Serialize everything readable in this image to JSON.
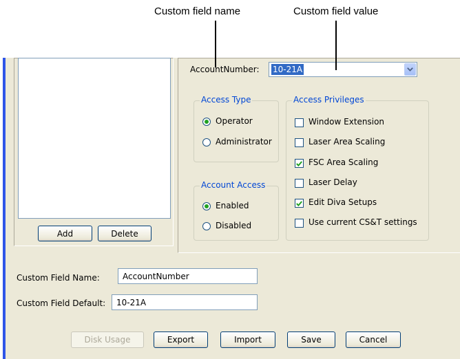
{
  "callouts": {
    "name_label": "Custom field name",
    "value_label": "Custom field value"
  },
  "account_field": {
    "label": "AccountNumber:",
    "value": "10-21A",
    "dropdown_icon": "chevron-down-icon"
  },
  "list_buttons": {
    "add": "Add",
    "delete": "Delete"
  },
  "access_type": {
    "title": "Access Type",
    "options": [
      {
        "label": "Operator",
        "selected": true
      },
      {
        "label": "Administrator",
        "selected": false
      }
    ]
  },
  "account_access": {
    "title": "Account Access",
    "options": [
      {
        "label": "Enabled",
        "selected": true
      },
      {
        "label": "Disabled",
        "selected": false
      }
    ]
  },
  "access_privileges": {
    "title": "Access Privileges",
    "items": [
      {
        "label": "Window Extension",
        "checked": false
      },
      {
        "label": "Laser Area Scaling",
        "checked": false
      },
      {
        "label": "FSC Area Scaling",
        "checked": true
      },
      {
        "label": "Laser Delay",
        "checked": false
      },
      {
        "label": "Edit Diva Setups",
        "checked": true
      },
      {
        "label": "Use current CS&T settings",
        "checked": false
      }
    ]
  },
  "custom_field": {
    "name_label": "Custom Field Name:",
    "name_value": "AccountNumber",
    "default_label": "Custom Field Default:",
    "default_value": "10-21A"
  },
  "footer": {
    "disk_usage": "Disk Usage",
    "export": "Export",
    "import": "Import",
    "save": "Save",
    "cancel": "Cancel"
  },
  "colors": {
    "window_bg": "#ece9d8",
    "group_title": "#0046d5",
    "selection": "#316ac5",
    "window_border": "#2f55e8",
    "check_mark": "#21a121"
  }
}
